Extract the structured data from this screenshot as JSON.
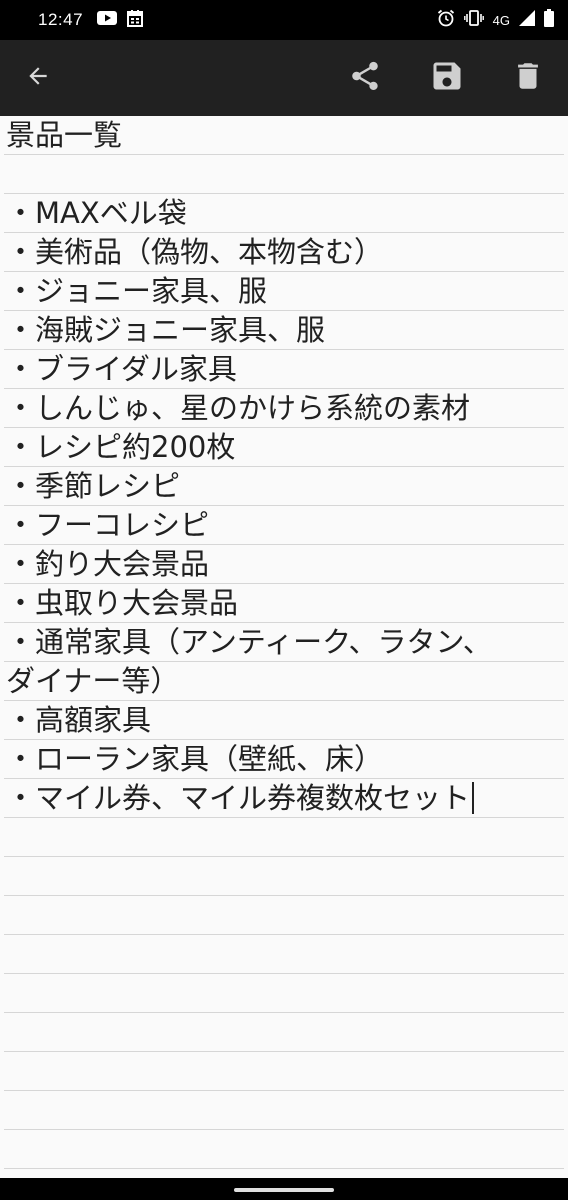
{
  "status_bar": {
    "time": "12:47",
    "network": "4G",
    "left_icons": [
      "youtube-icon",
      "calendar-icon"
    ],
    "right_icons": [
      "alarm-icon",
      "vibrate-icon",
      "signal-icon",
      "battery-icon"
    ]
  },
  "toolbar": {
    "back_icon": "arrow-back-icon",
    "share_icon": "share-icon",
    "save_icon": "save-icon",
    "delete_icon": "delete-icon"
  },
  "note": {
    "lines": [
      "景品一覧",
      "",
      "・MAXベル袋",
      "・美術品（偽物、本物含む）",
      "・ジョニー家具、服",
      "・海賊ジョニー家具、服",
      "・ブライダル家具",
      "・しんじゅ、星のかけら系統の素材",
      "・レシピ約200枚",
      "・季節レシピ",
      "・フーコレシピ",
      "・釣り大会景品",
      "・虫取り大会景品",
      "・通常家具（アンティーク、ラタン、",
      "ダイナー等）",
      "・高額家具",
      "・ローラン家具（壁紙、床）",
      "・マイル券、マイル券複数枚セット"
    ]
  },
  "colors": {
    "status_bar": "#000000",
    "app_bar": "#212121",
    "icon": "#cfcfcf",
    "paper": "#fafafa",
    "rule_line": "#d6d6d6",
    "text": "#212121"
  }
}
